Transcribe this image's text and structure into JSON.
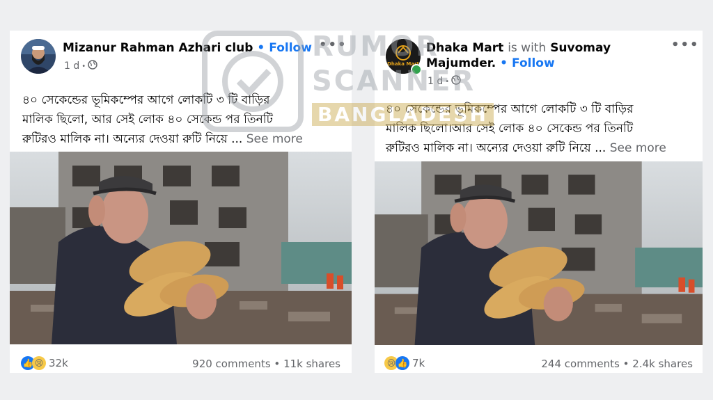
{
  "posts": [
    {
      "page_name": "Mizanur Rahman Azhari club",
      "with_text": "",
      "with_name": "",
      "follow_label": "Follow",
      "time": "1 d",
      "caption_line1": "৪০ সেকেন্ডের  ভূমিকম্পের আগে লোকটি ৩ টি বাড়ির",
      "caption_line2": "মালিক ছিলো, আর সেই লোক ৪০ সেকেন্ড পর তিনটি",
      "caption_line3": "রুটিরও মালিক না। অন্যের দেওয়া রুটি নিয়ে ...",
      "see_more": "See more",
      "reaction_count": "32k",
      "comments": "920 comments",
      "shares": "11k shares"
    },
    {
      "page_name": "Dhaka Mart",
      "with_text": "is with",
      "with_name": "Suvomay",
      "with_name2": "Majumder.",
      "follow_label": "Follow",
      "time": "1 d",
      "avatar_text": "Dhaka Mart",
      "caption_line1": "৪০ সেকেন্ডের  ভূমিকম্পের আগে লোকটি ৩ টি বাড়ির",
      "caption_line2": "মালিক ছিলো।আর সেই লোক ৪০ সেকেন্ড পর তিনটি",
      "caption_line3": "রুটিরও মালিক না। অন্যের দেওয়া রুটি নিয়ে ...",
      "see_more": "See more",
      "reaction_count": "7k",
      "comments": "244 comments",
      "shares": "2.4k shares"
    }
  ],
  "separator": "•",
  "watermark": {
    "line1": "RUMOR",
    "line2": "SCANNER",
    "line3": "BANGLADESH"
  },
  "colors": {
    "brand_blue": "#1877f2",
    "muted": "#65676b",
    "page_bg": "#eeeff1"
  }
}
